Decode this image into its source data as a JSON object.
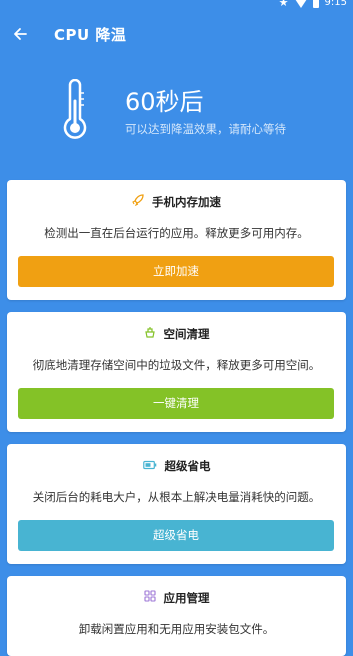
{
  "status_bar": {
    "time": "9:15"
  },
  "toolbar": {
    "title": "CPU 降温"
  },
  "hero": {
    "main": "60秒后",
    "subtitle": "可以达到降温效果，请耐心等待"
  },
  "cards": [
    {
      "title": "手机内存加速",
      "description": "检测出一直在后台运行的应用。释放更多可用内存。",
      "button": "立即加速",
      "icon": "rocket-icon",
      "color": "#f0a012"
    },
    {
      "title": "空间清理",
      "description": "彻底地清理存储空间中的垃圾文件，释放更多可用空间。",
      "button": "一键清理",
      "icon": "broom-icon",
      "color": "#84c227"
    },
    {
      "title": "超级省电",
      "description": "关闭后台的耗电大户，从根本上解决电量消耗快的问题。",
      "button": "超级省电",
      "icon": "battery-icon",
      "color": "#48b4d2"
    },
    {
      "title": "应用管理",
      "description": "卸载闲置应用和无用应用安装包文件。",
      "icon": "apps-icon",
      "color": "#9b74d6"
    }
  ]
}
